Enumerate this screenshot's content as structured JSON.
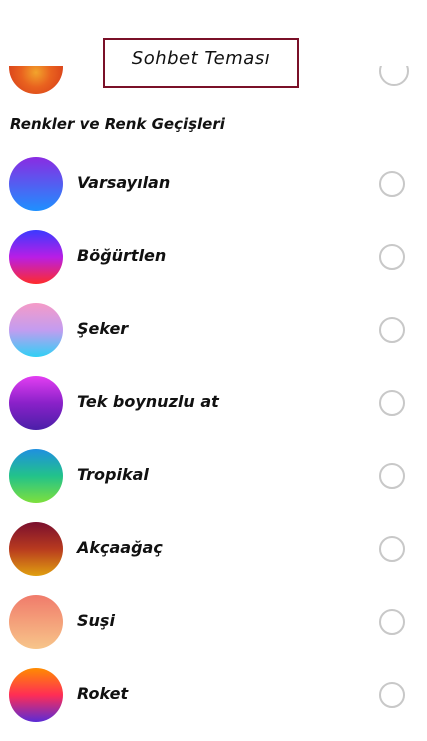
{
  "sheet": {
    "title": "Sohbet Teması"
  },
  "section": {
    "header": "Renkler ve Renk Geçişleri"
  },
  "themes": [
    {
      "label": "Varsayılan",
      "gradient": [
        "#8a2be2",
        "#1e90ff"
      ]
    },
    {
      "label": "Böğürtlen",
      "gradient": [
        "#3a3aff",
        "#b81ee6",
        "#ff2b2b"
      ]
    },
    {
      "label": "Şeker",
      "gradient": [
        "#f59bc7",
        "#c39cf0",
        "#2fd0f5"
      ]
    },
    {
      "label": "Tek boynuzlu at",
      "gradient": [
        "#e33ef2",
        "#8a21c9",
        "#4a1fa8"
      ]
    },
    {
      "label": "Tropikal",
      "gradient": [
        "#1f8fe0",
        "#22c28a",
        "#7ee03c"
      ]
    },
    {
      "label": "Akçaağaç",
      "gradient": [
        "#7a0f2e",
        "#b83a1f",
        "#e0a010"
      ]
    },
    {
      "label": "Suşi",
      "gradient": [
        "#f07b6b",
        "#f4a07a",
        "#f7c58a"
      ]
    },
    {
      "label": "Roket",
      "gradient": [
        "#ff8c00",
        "#ff2d55",
        "#5a2bd6"
      ]
    }
  ]
}
